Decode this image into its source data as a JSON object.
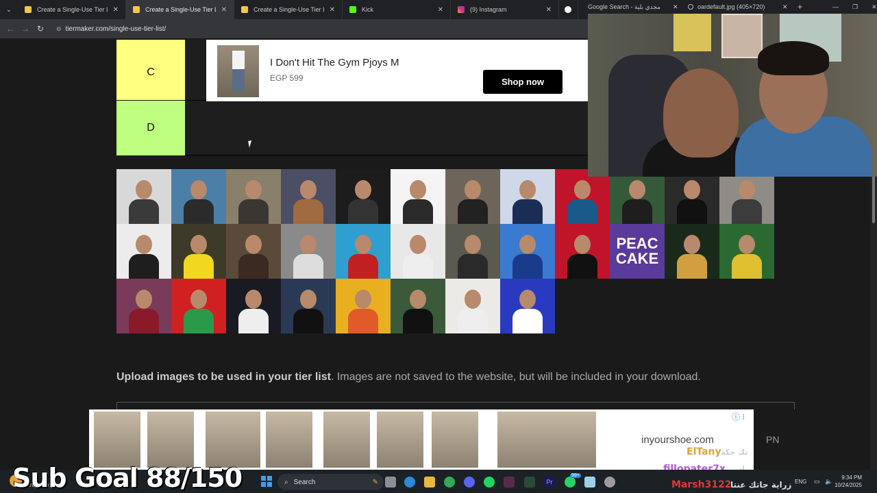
{
  "browser": {
    "tabs": [
      {
        "title": "Create a Single-Use Tier List (P",
        "icon": "tiermaker-favicon",
        "active": false
      },
      {
        "title": "Create a Single-Use Tier List (P",
        "icon": "tiermaker-favicon",
        "active": true
      },
      {
        "title": "Create a Single-Use Tier List (P",
        "icon": "tiermaker-favicon",
        "active": false
      },
      {
        "title": "Kick",
        "icon": "kick-favicon",
        "active": false
      },
      {
        "title": "(9) Instagram",
        "icon": "instagram-favicon",
        "active": false
      },
      {
        "title": "",
        "icon": "google-favicon",
        "active": false
      },
      {
        "title": "Google Search - مجدي بلية",
        "icon": "",
        "active": false
      },
      {
        "title": "oardefault.jpg (405×720)",
        "icon": "globe-favicon",
        "active": false
      }
    ],
    "url": "tiermaker.com/single-use-tier-list/"
  },
  "tiers": [
    {
      "label": "C",
      "color": "#ffff7f"
    },
    {
      "label": "D",
      "color": "#bfff7f"
    }
  ],
  "ad": {
    "title": "I Don't Hit The Gym Pjoys M",
    "price": "EGP 599",
    "button": "Shop now"
  },
  "grid_tiles": [
    {
      "bg": "#d8d8d8",
      "shirt": "#3a3a3a"
    },
    {
      "bg": "#4c7fa8",
      "shirt": "#2b2b2b"
    },
    {
      "bg": "#8a7f6a",
      "shirt": "#3a3632"
    },
    {
      "bg": "#4a4f66",
      "shirt": "#a06b40"
    },
    {
      "bg": "#1c1c1c",
      "shirt": "#333"
    },
    {
      "bg": "#f4f4f4",
      "shirt": "#2a2a2a"
    },
    {
      "bg": "#6e655a",
      "shirt": "#222"
    },
    {
      "bg": "#cfd8e8",
      "shirt": "#1a2e55"
    },
    {
      "bg": "#c0142a",
      "shirt": "#1a5a8a"
    },
    {
      "bg": "#355a3a",
      "shirt": "#1e1e1e"
    },
    {
      "bg": "#2a2a2a",
      "shirt": "#111"
    },
    {
      "bg": "#8f8c85",
      "shirt": "#3c3c3c"
    },
    {
      "bg": "#ececec",
      "shirt": "#1e1e1e"
    },
    {
      "bg": "#3e3a2a",
      "shirt": "#f0d820"
    },
    {
      "bg": "#5a4a3a",
      "shirt": "#3a2a22"
    },
    {
      "bg": "#8a8a8a",
      "shirt": "#ddd"
    },
    {
      "bg": "#2f9fd0",
      "shirt": "#c02020"
    },
    {
      "bg": "#e8e8e8",
      "shirt": "#eee"
    },
    {
      "bg": "#5a5a50",
      "shirt": "#2a2a2a"
    },
    {
      "bg": "#3a7ad0",
      "shirt": "#1a3a8a"
    },
    {
      "bg": "#c0142a",
      "shirt": "#111"
    },
    {
      "bg": "#5a3a9a",
      "text": "PEAC\nCAKE"
    },
    {
      "bg": "#1a2a1a",
      "shirt": "#d0a040"
    },
    {
      "bg": "#2a6a30",
      "shirt": "#e0c030"
    },
    {
      "bg": "#7a3a5a",
      "shirt": "#8a1a2a"
    },
    {
      "bg": "#d02020",
      "shirt": "#2a9a4a"
    },
    {
      "bg": "#1a1a22",
      "shirt": "#eee"
    },
    {
      "bg": "#2a3a55",
      "shirt": "#111"
    },
    {
      "bg": "#e8b020",
      "shirt": "#e05a2a"
    },
    {
      "bg": "#3a5a3a",
      "shirt": "#111"
    },
    {
      "bg": "#eceae6",
      "shirt": "#eee"
    },
    {
      "bg": "#2a3ac0",
      "shirt": "#fff"
    }
  ],
  "upload": {
    "bold": "Upload images to be used in your tier list",
    "rest": ". Images are not saved to the website, but will be included in your download."
  },
  "bottom_ad": {
    "domain": "inyourshoe.com",
    "thumbs": 9
  },
  "stream_overlay": {
    "names": [
      {
        "text": "ElTany",
        "color": "#d9a33a"
      },
      {
        "text": "fillopater7x",
        "color": "#b15ad8"
      },
      {
        "text": "Marsh3122",
        "color": "#d93a3a"
      }
    ],
    "ar_text": [
      "تك حكه",
      "ادبیرو",
      "زراية جاتك عنتا"
    ],
    "pn": "PN",
    "sub_goal": "Sub Goal 88/150"
  },
  "taskbar": {
    "search_placeholder": "Search",
    "lang": "ENG",
    "time": "9:34 PM",
    "date": "10/24/2025",
    "weather": "Partly sunny",
    "badge": "99+"
  }
}
